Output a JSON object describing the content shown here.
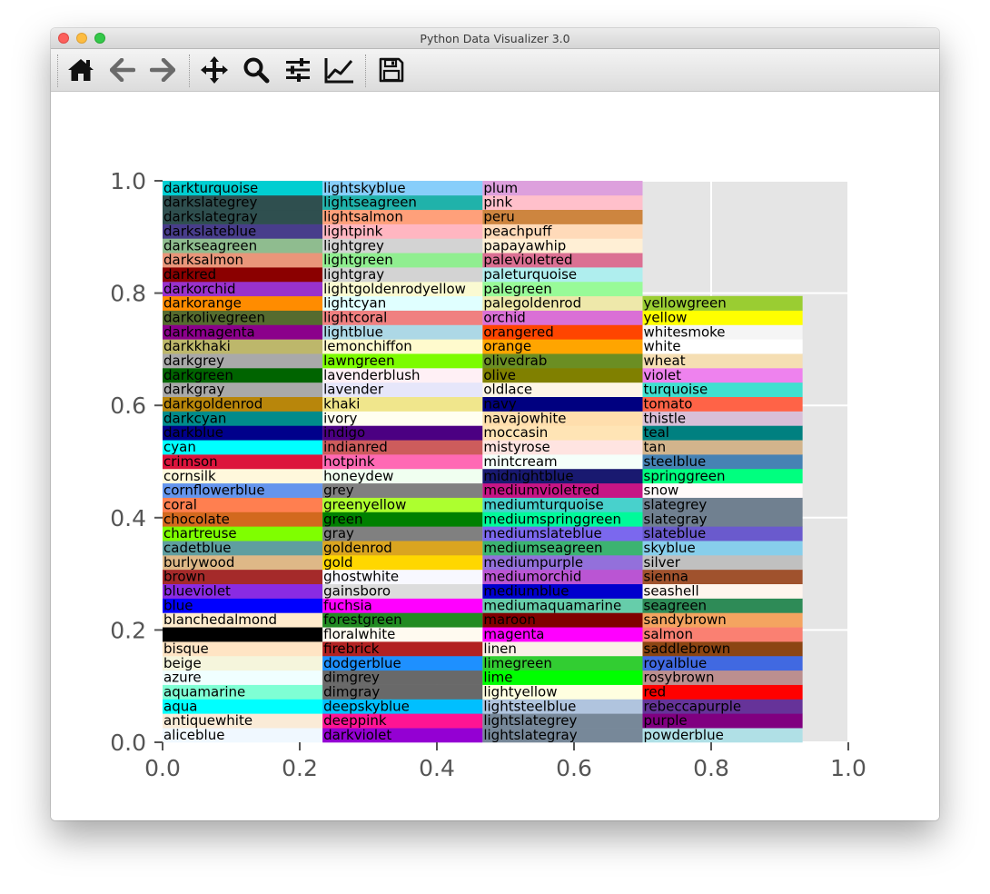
{
  "window": {
    "title": "Python Data Visualizer 3.0"
  },
  "toolbar": {
    "buttons": [
      {
        "name": "home-icon",
        "label": "Home"
      },
      {
        "name": "back-icon",
        "label": "Back"
      },
      {
        "name": "forward-icon",
        "label": "Forward"
      },
      {
        "name": "pan-icon",
        "label": "Pan"
      },
      {
        "name": "zoom-icon",
        "label": "Zoom"
      },
      {
        "name": "subplots-icon",
        "label": "Subplots"
      },
      {
        "name": "customize-icon",
        "label": "Customize"
      },
      {
        "name": "save-icon",
        "label": "Save"
      }
    ]
  },
  "chart_data": {
    "type": "table",
    "title": "",
    "xlabel": "",
    "ylabel": "",
    "xlim": [
      0.0,
      1.0
    ],
    "ylim": [
      0.0,
      1.0
    ],
    "x_ticks": [
      "0.0",
      "0.2",
      "0.4",
      "0.6",
      "0.8",
      "1.0"
    ],
    "y_ticks": [
      "0.0",
      "0.2",
      "0.4",
      "0.6",
      "0.8",
      "1.0"
    ],
    "grid": true,
    "background": "#e5e5e5",
    "cell_height": 0.02564,
    "columns": [
      {
        "x0": 0.0,
        "x1": 0.2333,
        "colors": [
          "aliceblue",
          "antiquewhite",
          "aqua",
          "aquamarine",
          "azure",
          "beige",
          "bisque",
          "black",
          "blanchedalmond",
          "blue",
          "blueviolet",
          "brown",
          "burlywood",
          "cadetblue",
          "chartreuse",
          "chocolate",
          "coral",
          "cornflowerblue",
          "cornsilk",
          "crimson",
          "cyan",
          "darkblue",
          "darkcyan",
          "darkgoldenrod",
          "darkgray",
          "darkgreen",
          "darkgrey",
          "darkkhaki",
          "darkmagenta",
          "darkolivegreen",
          "darkorange",
          "darkorchid",
          "darkred",
          "darksalmon",
          "darkseagreen",
          "darkslateblue",
          "darkslategray",
          "darkslategrey",
          "darkturquoise"
        ]
      },
      {
        "x0": 0.2333,
        "x1": 0.4667,
        "colors": [
          "darkviolet",
          "deeppink",
          "deepskyblue",
          "dimgray",
          "dimgrey",
          "dodgerblue",
          "firebrick",
          "floralwhite",
          "forestgreen",
          "fuchsia",
          "gainsboro",
          "ghostwhite",
          "gold",
          "goldenrod",
          "gray",
          "green",
          "greenyellow",
          "grey",
          "honeydew",
          "hotpink",
          "indianred",
          "indigo",
          "ivory",
          "khaki",
          "lavender",
          "lavenderblush",
          "lawngreen",
          "lemonchiffon",
          "lightblue",
          "lightcoral",
          "lightcyan",
          "lightgoldenrodyellow",
          "lightgray",
          "lightgreen",
          "lightgrey",
          "lightpink",
          "lightsalmon",
          "lightseagreen",
          "lightskyblue"
        ]
      },
      {
        "x0": 0.4667,
        "x1": 0.7,
        "colors": [
          "lightslategray",
          "lightslategrey",
          "lightsteelblue",
          "lightyellow",
          "lime",
          "limegreen",
          "linen",
          "magenta",
          "maroon",
          "mediumaquamarine",
          "mediumblue",
          "mediumorchid",
          "mediumpurple",
          "mediumseagreen",
          "mediumslateblue",
          "mediumspringgreen",
          "mediumturquoise",
          "mediumvioletred",
          "midnightblue",
          "mintcream",
          "mistyrose",
          "moccasin",
          "navajowhite",
          "navy",
          "oldlace",
          "olive",
          "olivedrab",
          "orange",
          "orangered",
          "orchid",
          "palegoldenrod",
          "palegreen",
          "paleturquoise",
          "palevioletred",
          "papayawhip",
          "peachpuff",
          "peru",
          "pink",
          "plum"
        ]
      },
      {
        "x0": 0.7,
        "x1": 0.9333,
        "colors": [
          "powderblue",
          "purple",
          "rebeccapurple",
          "red",
          "rosybrown",
          "royalblue",
          "saddlebrown",
          "salmon",
          "sandybrown",
          "seagreen",
          "seashell",
          "sienna",
          "silver",
          "skyblue",
          "slateblue",
          "slategray",
          "slategrey",
          "snow",
          "springgreen",
          "steelblue",
          "tan",
          "teal",
          "thistle",
          "tomato",
          "turquoise",
          "violet",
          "wheat",
          "white",
          "whitesmoke",
          "yellow",
          "yellowgreen"
        ]
      }
    ]
  }
}
